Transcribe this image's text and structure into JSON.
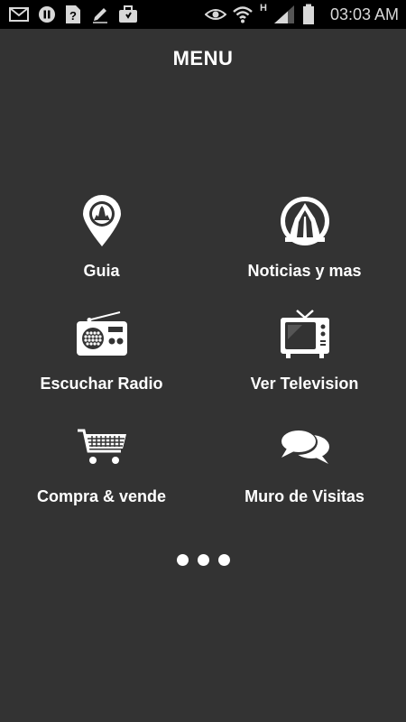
{
  "status_bar": {
    "time": "03:03 AM",
    "network_label": "H",
    "icons": [
      "mail-icon",
      "pause-icon",
      "unknown-app-icon",
      "pencil-icon",
      "briefcase-icon",
      "eye-icon",
      "wifi-icon",
      "signal-icon",
      "battery-icon"
    ]
  },
  "header": {
    "title": "MENU"
  },
  "menu": {
    "items": [
      {
        "label": "Guia",
        "icon": "map-pin-icon"
      },
      {
        "label": "Noticias y mas",
        "icon": "news-dome-icon"
      },
      {
        "label": "Escuchar Radio",
        "icon": "radio-icon"
      },
      {
        "label": "Ver Television",
        "icon": "tv-icon"
      },
      {
        "label": "Compra & vende",
        "icon": "cart-icon"
      },
      {
        "label": "Muro de Visitas",
        "icon": "chat-bubbles-icon"
      }
    ]
  },
  "pagination": {
    "dots": 3
  }
}
